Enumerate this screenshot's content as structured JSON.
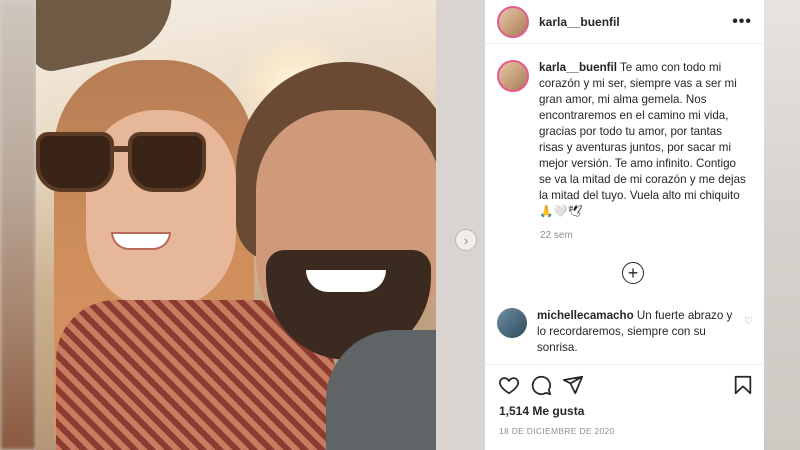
{
  "post": {
    "username": "karla__buenfil",
    "more_label": "•••",
    "caption": {
      "user": "karla__buenfil",
      "text": "Te amo con todo mi corazón y mi ser, siempre vas a ser mi gran amor, mi alma gemela. Nos encontraremos en el camino mi vida, gracias por todo tu amor, por tantas risas y aventuras juntos, por sacar mi mejor versión. Te amo infinito. Contigo se va la mitad de mi corazón y me dejas la mitad del tuyo. Vuela alto mi chiquito🙏🤍🕊"
    },
    "caption_time": "22 sem",
    "load_more_icon": "plus-circle-icon",
    "comment": {
      "user": "michellecamacho",
      "text": "Un fuerte abrazo y lo recordaremos, siempre con su sonrisa."
    },
    "likes": "1,514 Me gusta",
    "date": "18 DE DICIEMBRE DE 2020"
  },
  "icons": {
    "next": "chevron-right-icon",
    "like": "heart-icon",
    "comment": "comment-icon",
    "share": "send-icon",
    "save": "bookmark-icon",
    "comment_like": "heart-icon"
  },
  "colors": {
    "text": "#262626",
    "muted": "#8e8e8e",
    "avatar_ring": "#e35b8f"
  }
}
